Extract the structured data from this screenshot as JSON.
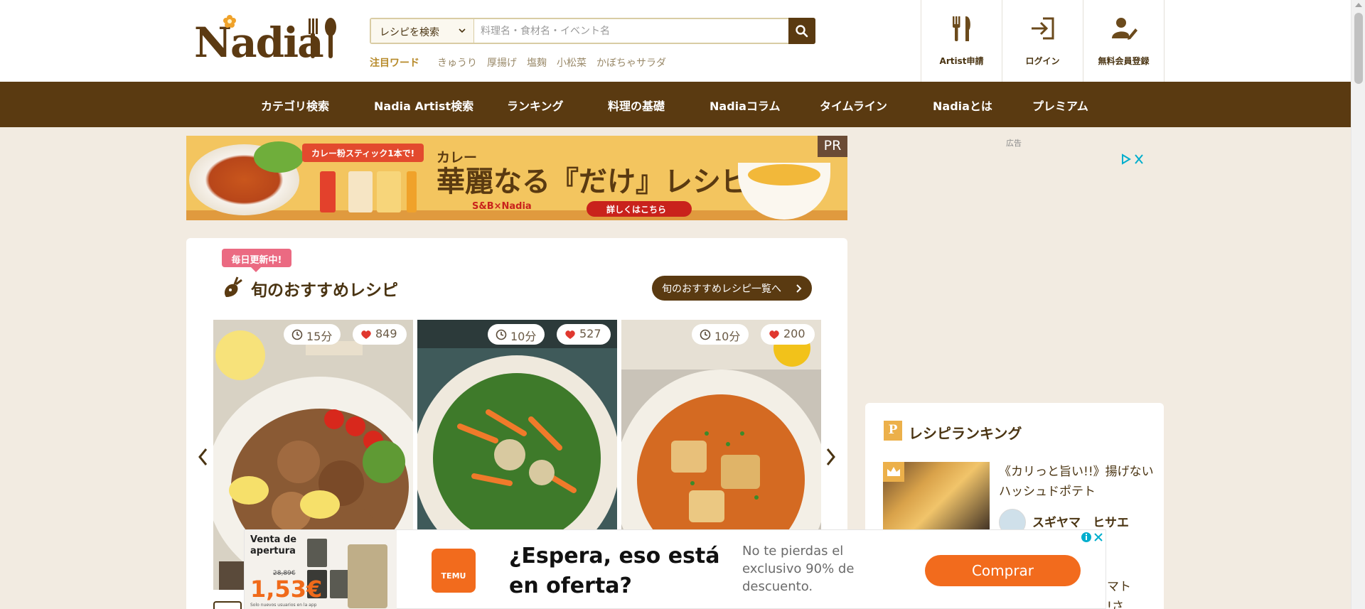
{
  "header": {
    "logo_text": "Nadia",
    "search": {
      "select_label": "レシピを検索",
      "placeholder": "料理名・食材名・イベント名"
    },
    "keywords": {
      "label": "注目ワード",
      "items": [
        "きゅうり",
        "厚揚げ",
        "塩麹",
        "小松菜",
        "かぼちゃサラダ"
      ]
    },
    "nav_buttons": [
      {
        "label": "Artist申請",
        "icon": "fork-knife-icon"
      },
      {
        "label": "ログイン",
        "icon": "login-icon"
      },
      {
        "label": "無料会員登録",
        "icon": "user-edit-icon"
      }
    ]
  },
  "main_nav": {
    "items": [
      "カテゴリ検索",
      "Nadia Artist検索",
      "ランキング",
      "料理の基礎",
      "Nadiaコラム",
      "タイムライン",
      "Nadiaとは",
      "プレミアム"
    ]
  },
  "banner": {
    "tag": "カレー粉スティック1本で!",
    "subtitle": "カレー",
    "headline": "華麗なる『だけ』レシピ",
    "brand": "S&B×Nadia",
    "cta": "詳しくはこちら",
    "pr": "PR"
  },
  "ad_label": "広告",
  "recommend": {
    "badge": "毎日更新中!",
    "title": "旬のおすすめレシピ",
    "link": "旬のおすすめレシピ一覧へ",
    "recipes": [
      {
        "time": "15分",
        "likes": "849"
      },
      {
        "time": "10分",
        "likes": "527"
      },
      {
        "time": "10分",
        "likes": "200"
      }
    ]
  },
  "ranking": {
    "icon_letter": "P",
    "title": "レシピランキング",
    "top_item": {
      "name": "《カリっと旨い!!》揚げないハッシュドポテト",
      "user": "スギヤマ　ヒサエ"
    },
    "partial_text": "トマト\nい!さ"
  },
  "bottom_ad": {
    "sale_text": "Venta de apertura",
    "old_price": "28,89€",
    "price": "1,53€",
    "small_text": "Solo nuevos usuarios en la app",
    "brand": "TEMU",
    "headline": "¿Espera, eso está en oferta?",
    "description": "No te pierdas el exclusivo 90% de descuento.",
    "button": "Comprar"
  },
  "colors": {
    "brand_brown": "#5a3a11",
    "background": "#f2ebe1",
    "like_red": "#e0382f",
    "badge_pink": "#eb6a82",
    "accent_gold": "#ecb04a",
    "temu_orange": "#f26b1d"
  }
}
